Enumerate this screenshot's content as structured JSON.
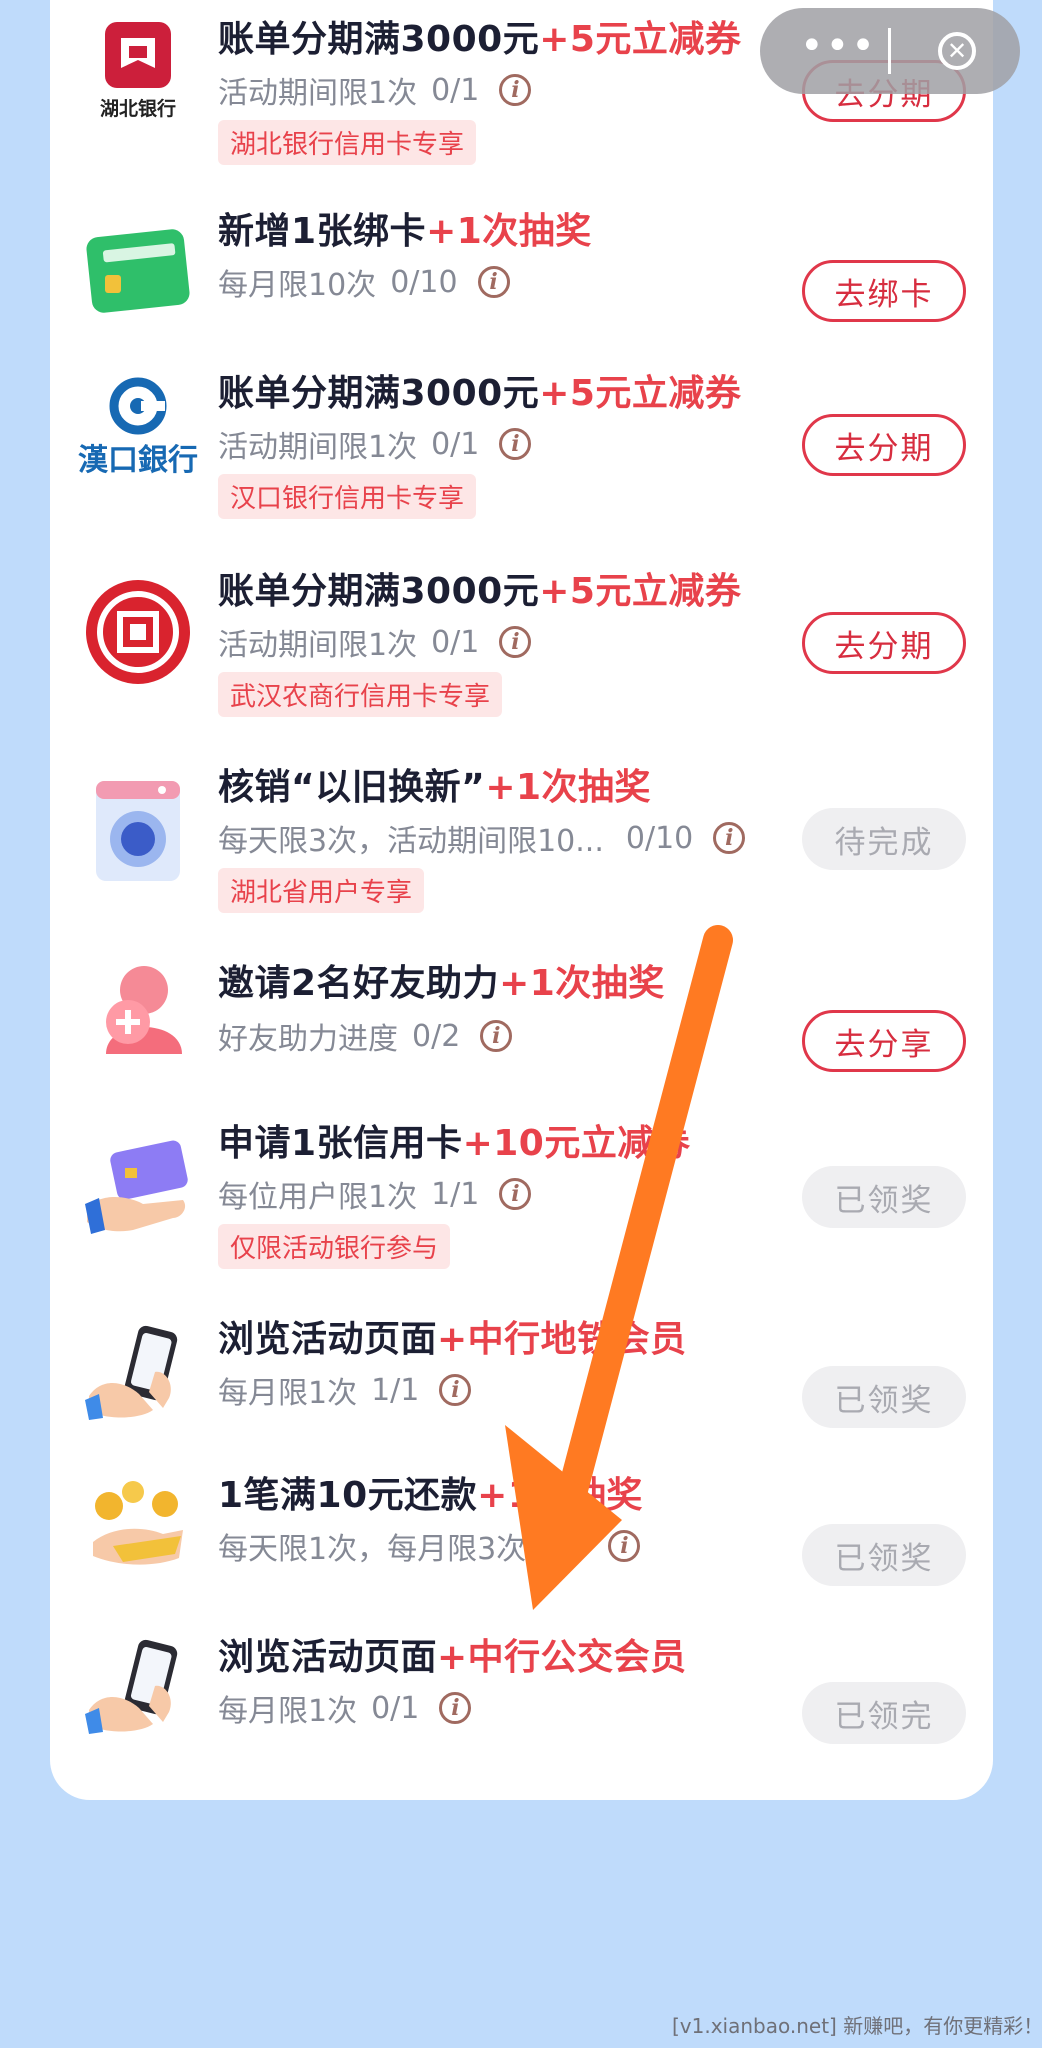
{
  "capsule": {
    "more_icon": "more-dots-icon",
    "close_icon": "close-circle-icon"
  },
  "tasks": [
    {
      "bank_icon": "hubei-bank-logo",
      "bank_text": "湖北银行",
      "title": "账单分期满3000元",
      "reward": "+5元立减券",
      "limit": "活动期间限1次",
      "progress": "0/1",
      "tag": "湖北银行信用卡专享",
      "button": "去分期"
    },
    {
      "title": "新增1张绑卡",
      "reward": "+1次抽奖",
      "limit": "每月限10次",
      "progress": "0/10",
      "button": "去绑卡"
    },
    {
      "bank_icon": "hankou-bank-logo",
      "bank_text": "漢口銀行",
      "title": "账单分期满3000元",
      "reward": "+5元立减券",
      "limit": "活动期间限1次",
      "progress": "0/1",
      "tag": "汉口银行信用卡专享",
      "button": "去分期"
    },
    {
      "bank_icon": "wuhan-rural-bank-logo",
      "title": "账单分期满3000元",
      "reward": "+5元立减券",
      "limit": "活动期间限1次",
      "progress": "0/1",
      "tag": "武汉农商行信用卡专享",
      "button": "去分期"
    },
    {
      "title": "核销“以旧换新”",
      "reward": "+1次抽奖",
      "limit": "每天限3次，活动期间限10...",
      "progress": "0/10",
      "tag": "湖北省用户专享",
      "button": "待完成"
    },
    {
      "title": "邀请2名好友助力",
      "reward": "+1次抽奖",
      "limit": "好友助力进度",
      "progress": "0/2",
      "button": "去分享"
    },
    {
      "title": "申请1张信用卡",
      "reward": "+10元立减券",
      "limit": "每位用户限1次",
      "progress": "1/1",
      "tag": "仅限活动银行参与",
      "button": "已领奖"
    },
    {
      "title": "浏览活动页面",
      "reward": "+中行地铁会员",
      "limit": "每月限1次",
      "progress": "1/1",
      "button": "已领奖"
    },
    {
      "title": "1笔满10元还款",
      "reward": "+1次抽奖",
      "limit": "每天限1次，每月限3次",
      "progress": "3/3",
      "button": "已领奖"
    },
    {
      "title": "浏览活动页面",
      "reward": "+中行公交会员",
      "limit": "每月限1次",
      "progress": "0/1",
      "button": "已领完"
    }
  ],
  "info_glyph": "i",
  "footer": "[v1.xianbao.net] 新赚吧，有你更精彩！",
  "colors": {
    "accent": "#e8424b",
    "background": "#bfdbfb",
    "arrow": "#ff7a22"
  }
}
